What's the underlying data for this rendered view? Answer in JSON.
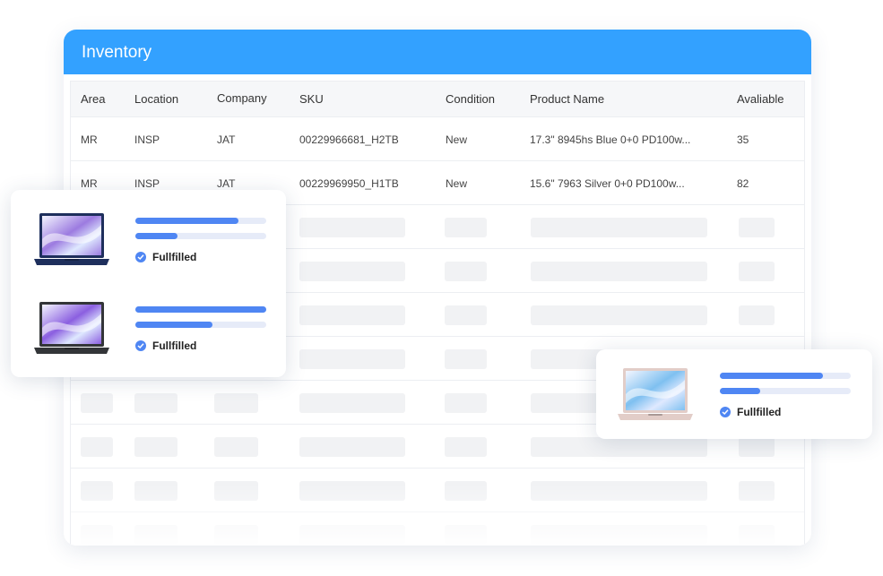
{
  "inventory": {
    "title": "Inventory",
    "columns": [
      "Area",
      "Location",
      "Company",
      "SKU",
      "Condition",
      "Product Name",
      "Avaliable"
    ],
    "rows": [
      {
        "area": "MR",
        "location": "INSP",
        "company": "JAT",
        "sku": "00229966681_H2TB",
        "condition": "New",
        "product": "17.3\" 8945hs Blue 0+0 PD100w...",
        "available": "35"
      },
      {
        "area": "MR",
        "location": "INSP",
        "company": "JAT",
        "sku": "00229969950_H1TB",
        "condition": "New",
        "product": "15.6\" 7963 Silver 0+0 PD100w...",
        "available": "82"
      }
    ]
  },
  "cards": [
    {
      "items": [
        {
          "status": "Fullfilled",
          "progress": [
            0.79,
            0.32
          ],
          "laptop_color": "#1e2f5c",
          "screen_accent": "#9c7be0"
        },
        {
          "status": "Fullfilled",
          "progress": [
            1.0,
            0.59
          ],
          "laptop_color": "#333538",
          "screen_accent": "#8b5fe0"
        }
      ]
    },
    {
      "items": [
        {
          "status": "Fullfilled",
          "progress": [
            0.79,
            0.31
          ],
          "laptop_color": "#e2cdc8",
          "screen_accent": "#7fc0f0"
        }
      ]
    }
  ]
}
